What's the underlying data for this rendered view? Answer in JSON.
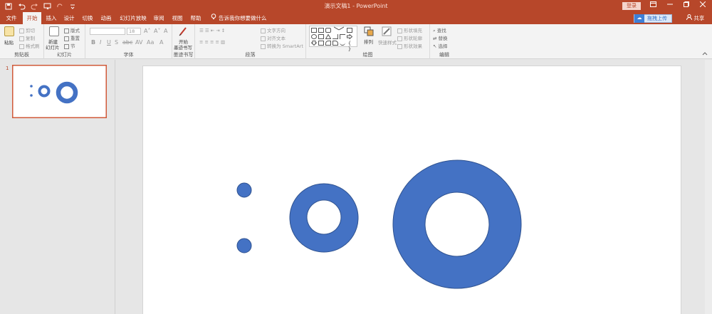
{
  "window": {
    "title": "演示文稿1 - PowerPoint",
    "login_label": "登录",
    "share_label": "共享"
  },
  "tabs": [
    "文件",
    "开始",
    "插入",
    "设计",
    "切换",
    "动画",
    "幻灯片放映",
    "审阅",
    "视图",
    "帮助"
  ],
  "active_tab": "开始",
  "tell_me": "告诉我你想要做什么",
  "baidu_upload": "拖拽上传",
  "ribbon": {
    "clipboard": {
      "label": "剪贴板",
      "paste": "粘贴",
      "cut": "剪切",
      "copy": "复制",
      "format_painter": "格式刷"
    },
    "slides": {
      "label": "幻灯片",
      "new_slide": "新建",
      "new_slide_2": "幻灯片",
      "layout": "版式",
      "reset": "重置",
      "section": "节"
    },
    "font": {
      "label": "字体",
      "size": "18"
    },
    "ink": {
      "label": "墨迹书写",
      "start": "开始",
      "start_2": "墨迹书写"
    },
    "paragraph": {
      "label": "段落",
      "text_direction": "文字方向",
      "align_text": "对齐文本",
      "smartart": "转换为 SmartArt"
    },
    "drawing": {
      "label": "绘图",
      "arrange": "排列",
      "quick_styles": "快速样式",
      "shape_fill": "形状填充",
      "shape_outline": "形状轮廓",
      "shape_effects": "形状效果"
    },
    "editing": {
      "label": "编辑",
      "find": "查找",
      "replace": "替换",
      "select": "选择"
    }
  },
  "slide_pane": {
    "slide_number": "1"
  },
  "colors": {
    "accent": "#b7472a",
    "shape_fill": "#4472c4",
    "shape_outline": "#2f528f"
  }
}
